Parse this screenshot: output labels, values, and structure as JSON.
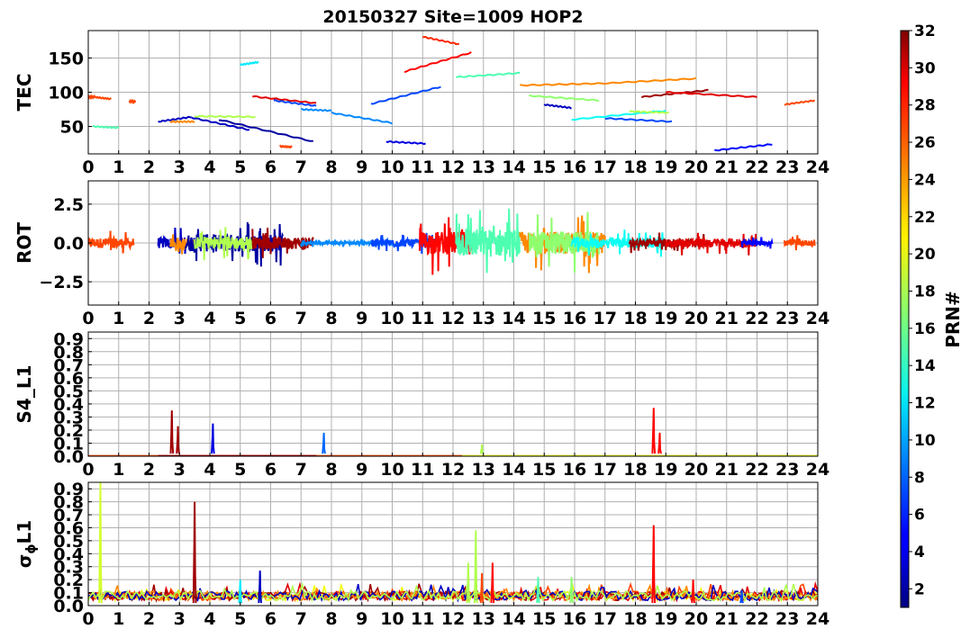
{
  "chart_data": {
    "type": "line",
    "title": "20150327 Site=1009 HOP2",
    "x_ticks": [
      "0",
      "1",
      "2",
      "3",
      "4",
      "5",
      "6",
      "7",
      "8",
      "9",
      "10",
      "11",
      "12",
      "13",
      "14",
      "15",
      "16",
      "17",
      "18",
      "19",
      "20",
      "21",
      "22",
      "23",
      "24"
    ],
    "xlim": [
      0,
      24
    ],
    "grid": true,
    "colorbar": {
      "label": "PRN#",
      "range": [
        1,
        32
      ],
      "ticks": [
        "2",
        "4",
        "6",
        "8",
        "10",
        "12",
        "14",
        "16",
        "18",
        "20",
        "22",
        "24",
        "26",
        "28",
        "30",
        "32"
      ],
      "colormap": "jet"
    },
    "panels": [
      {
        "id": "tec",
        "ylabel": "TEC",
        "ylim": [
          10,
          190
        ],
        "yticks": [
          "50",
          "100",
          "150"
        ],
        "segments": [
          {
            "prn": 26,
            "t0": 0.0,
            "t1": 0.2,
            "v0": 93,
            "v1": 93
          },
          {
            "prn": 26,
            "t0": 0.2,
            "t1": 0.75,
            "v0": 93,
            "v1": 90
          },
          {
            "prn": 26,
            "t0": 1.35,
            "t1": 1.55,
            "v0": 87,
            "v1": 86
          },
          {
            "prn": 15,
            "t0": 0.15,
            "t1": 1.0,
            "v0": 50,
            "v1": 48
          },
          {
            "prn": 3,
            "t0": 2.3,
            "t1": 3.4,
            "v0": 57,
            "v1": 64
          },
          {
            "prn": 3,
            "t0": 3.4,
            "t1": 5.3,
            "v0": 63,
            "v1": 45
          },
          {
            "prn": 24,
            "t0": 2.7,
            "t1": 3.5,
            "v0": 57,
            "v1": 57
          },
          {
            "prn": 18,
            "t0": 3.5,
            "t1": 5.5,
            "v0": 65,
            "v1": 64
          },
          {
            "prn": 2,
            "t0": 4.3,
            "t1": 7.4,
            "v0": 60,
            "v1": 28
          },
          {
            "prn": 12,
            "t0": 5.0,
            "t1": 5.6,
            "v0": 140,
            "v1": 144
          },
          {
            "prn": 29,
            "t0": 5.4,
            "t1": 7.5,
            "v0": 94,
            "v1": 84
          },
          {
            "prn": 26,
            "t0": 6.3,
            "t1": 6.7,
            "v0": 21,
            "v1": 20
          },
          {
            "prn": 7,
            "t0": 6.1,
            "t1": 7.5,
            "v0": 88,
            "v1": 80
          },
          {
            "prn": 9,
            "t0": 7.0,
            "t1": 8.0,
            "v0": 75,
            "v1": 73
          },
          {
            "prn": 9,
            "t0": 8.0,
            "t1": 10.0,
            "v0": 70,
            "v1": 55
          },
          {
            "prn": 7,
            "t0": 9.3,
            "t1": 11.6,
            "v0": 83,
            "v1": 108
          },
          {
            "prn": 4,
            "t0": 9.8,
            "t1": 11.1,
            "v0": 28,
            "v1": 25
          },
          {
            "prn": 28,
            "t0": 10.4,
            "t1": 12.6,
            "v0": 130,
            "v1": 158
          },
          {
            "prn": 27,
            "t0": 11.0,
            "t1": 12.2,
            "v0": 181,
            "v1": 170
          },
          {
            "prn": 15,
            "t0": 12.1,
            "t1": 14.2,
            "v0": 122,
            "v1": 128
          },
          {
            "prn": 24,
            "t0": 14.2,
            "t1": 17.0,
            "v0": 110,
            "v1": 113
          },
          {
            "prn": 17,
            "t0": 14.5,
            "t1": 16.8,
            "v0": 95,
            "v1": 88
          },
          {
            "prn": 3,
            "t0": 15.0,
            "t1": 15.9,
            "v0": 82,
            "v1": 77
          },
          {
            "prn": 24,
            "t0": 17.0,
            "t1": 20.0,
            "v0": 113,
            "v1": 120
          },
          {
            "prn": 13,
            "t0": 15.9,
            "t1": 19.0,
            "v0": 60,
            "v1": 73
          },
          {
            "prn": 18,
            "t0": 17.8,
            "t1": 19.1,
            "v0": 72,
            "v1": 70
          },
          {
            "prn": 7,
            "t0": 17.0,
            "t1": 19.2,
            "v0": 62,
            "v1": 57
          },
          {
            "prn": 31,
            "t0": 18.2,
            "t1": 20.4,
            "v0": 93,
            "v1": 103
          },
          {
            "prn": 29,
            "t0": 19.0,
            "t1": 22.0,
            "v0": 100,
            "v1": 93
          },
          {
            "prn": 5,
            "t0": 20.6,
            "t1": 22.5,
            "v0": 15,
            "v1": 24
          },
          {
            "prn": 26,
            "t0": 22.9,
            "t1": 23.9,
            "v0": 82,
            "v1": 88
          }
        ]
      },
      {
        "id": "rot",
        "ylabel": "ROT",
        "ylim": [
          -4,
          4
        ],
        "yticks": [
          "−2.5",
          "0.0",
          "2.5"
        ],
        "noisy_segments": [
          {
            "prn": 26,
            "t0": 0.0,
            "t1": 1.5,
            "amp": 0.9
          },
          {
            "prn": 3,
            "t0": 2.3,
            "t1": 3.2,
            "amp": 1.0
          },
          {
            "prn": 24,
            "t0": 2.7,
            "t1": 3.5,
            "amp": 0.8
          },
          {
            "prn": 2,
            "t0": 3.2,
            "t1": 6.4,
            "amp": 1.6
          },
          {
            "prn": 18,
            "t0": 3.5,
            "t1": 5.5,
            "amp": 1.2
          },
          {
            "prn": 31,
            "t0": 5.4,
            "t1": 7.4,
            "amp": 1.1
          },
          {
            "prn": 9,
            "t0": 7.0,
            "t1": 10.0,
            "amp": 0.25
          },
          {
            "prn": 7,
            "t0": 9.3,
            "t1": 11.5,
            "amp": 0.7
          },
          {
            "prn": 28,
            "t0": 10.9,
            "t1": 12.7,
            "amp": 2.1
          },
          {
            "prn": 15,
            "t0": 12.1,
            "t1": 14.2,
            "amp": 2.6
          },
          {
            "prn": 24,
            "t0": 14.2,
            "t1": 17.0,
            "amp": 2.0
          },
          {
            "prn": 17,
            "t0": 14.5,
            "t1": 16.8,
            "amp": 2.1
          },
          {
            "prn": 13,
            "t0": 15.9,
            "t1": 19.0,
            "amp": 0.9
          },
          {
            "prn": 31,
            "t0": 17.8,
            "t1": 20.4,
            "amp": 0.7
          },
          {
            "prn": 29,
            "t0": 19.0,
            "t1": 22.0,
            "amp": 0.8
          },
          {
            "prn": 5,
            "t0": 21.5,
            "t1": 22.5,
            "amp": 0.4
          },
          {
            "prn": 26,
            "t0": 22.9,
            "t1": 23.9,
            "amp": 0.5
          }
        ]
      },
      {
        "id": "s4",
        "ylabel": "S4_L1",
        "ylim": [
          0,
          0.95
        ],
        "yticks": [
          "0.0",
          "0.1",
          "0.2",
          "0.3",
          "0.4",
          "0.5",
          "0.6",
          "0.7",
          "0.8",
          "0.9"
        ],
        "spikes": [
          {
            "prn": 31,
            "t": 2.75,
            "v": 0.35
          },
          {
            "prn": 31,
            "t": 2.95,
            "v": 0.23
          },
          {
            "prn": 4,
            "t": 4.1,
            "v": 0.25
          },
          {
            "prn": 8,
            "t": 7.75,
            "v": 0.18
          },
          {
            "prn": 18,
            "t": 12.95,
            "v": 0.09
          },
          {
            "prn": 28,
            "t": 18.6,
            "v": 0.37
          },
          {
            "prn": 28,
            "t": 18.8,
            "v": 0.18
          }
        ]
      },
      {
        "id": "sigma",
        "ylabel": "σϕL1",
        "ylim": [
          0,
          0.95
        ],
        "yticks": [
          "0.0",
          "0.1",
          "0.2",
          "0.3",
          "0.4",
          "0.5",
          "0.6",
          "0.7",
          "0.8",
          "0.9"
        ],
        "baseline_prns": [
          20,
          26,
          29,
          31,
          24,
          3,
          18
        ],
        "spikes": [
          {
            "prn": 19,
            "t": 0.4,
            "v": 0.95
          },
          {
            "prn": 31,
            "t": 3.5,
            "v": 0.8
          },
          {
            "prn": 3,
            "t": 5.65,
            "v": 0.27
          },
          {
            "prn": 12,
            "t": 5.0,
            "v": 0.2
          },
          {
            "prn": 18,
            "t": 12.5,
            "v": 0.33
          },
          {
            "prn": 18,
            "t": 12.75,
            "v": 0.58
          },
          {
            "prn": 26,
            "t": 12.95,
            "v": 0.25
          },
          {
            "prn": 28,
            "t": 13.3,
            "v": 0.33
          },
          {
            "prn": 15,
            "t": 14.8,
            "v": 0.22
          },
          {
            "prn": 17,
            "t": 15.9,
            "v": 0.22
          },
          {
            "prn": 28,
            "t": 18.6,
            "v": 0.62
          },
          {
            "prn": 28,
            "t": 19.9,
            "v": 0.2
          },
          {
            "prn": 7,
            "t": 21.5,
            "v": 0.12
          }
        ]
      }
    ]
  }
}
